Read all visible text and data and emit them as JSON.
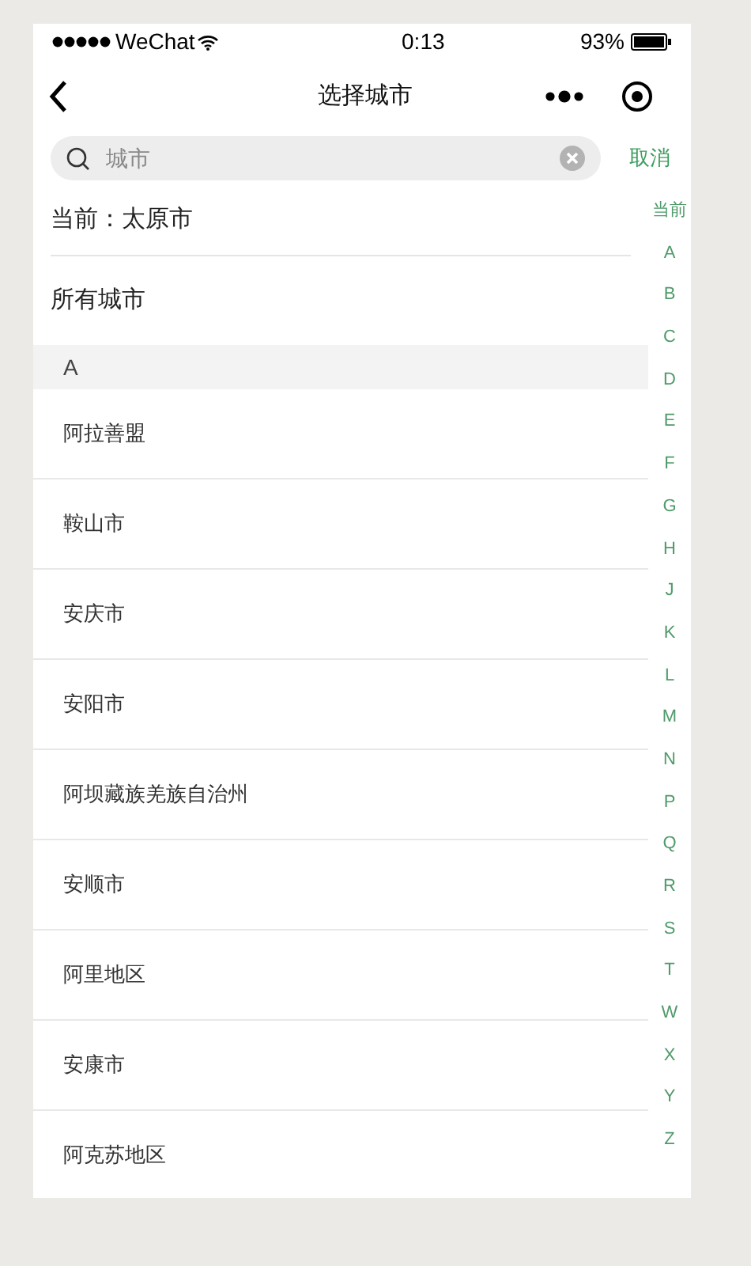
{
  "status_bar": {
    "carrier": "WeChat",
    "time": "0:13",
    "battery": "93%"
  },
  "nav": {
    "title": "选择城市"
  },
  "search": {
    "placeholder": "城市",
    "cancel": "取消"
  },
  "current": {
    "label": "当前：太原市"
  },
  "all_cities": {
    "label": "所有城市"
  },
  "sections": [
    {
      "letter": "A",
      "cities": [
        "阿拉善盟",
        "鞍山市",
        "安庆市",
        "安阳市",
        "阿坝藏族羌族自治州",
        "安顺市",
        "阿里地区",
        "安康市",
        "阿克苏地区"
      ]
    }
  ],
  "index": [
    "当前",
    "A",
    "B",
    "C",
    "D",
    "E",
    "F",
    "G",
    "H",
    "J",
    "K",
    "L",
    "M",
    "N",
    "P",
    "Q",
    "R",
    "S",
    "T",
    "W",
    "X",
    "Y",
    "Z"
  ]
}
